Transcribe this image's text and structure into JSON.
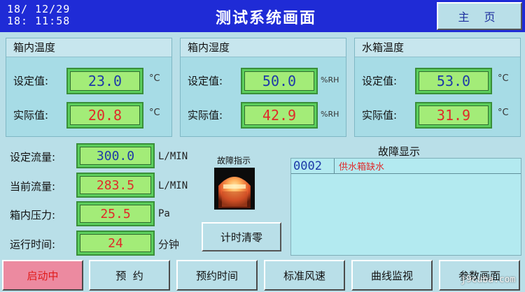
{
  "header": {
    "datetime": "18/ 12/29\n18: 11:58",
    "title": "测试系统画面",
    "home_label": "主 页"
  },
  "panels": [
    {
      "title": "箱内温度",
      "set_label": "设定值:",
      "set_value": "23.0",
      "actual_label": "实际值:",
      "actual_value": "20.8",
      "unit": "°C"
    },
    {
      "title": "箱内湿度",
      "set_label": "设定值:",
      "set_value": "50.0",
      "actual_label": "实际值:",
      "actual_value": "42.9",
      "unit": "%RH"
    },
    {
      "title": "水箱温度",
      "set_label": "设定值:",
      "set_value": "53.0",
      "actual_label": "实际值:",
      "actual_value": "31.9",
      "unit": "°C"
    }
  ],
  "flow": {
    "set_flow_label": "设定流量:",
    "set_flow_value": "300.0",
    "set_flow_unit": "L/MIN",
    "current_flow_label": "当前流量:",
    "current_flow_value": "283.5",
    "current_flow_unit": "L/MIN",
    "pressure_label": "箱内压力:",
    "pressure_value": "25.5",
    "pressure_unit": "Pa",
    "runtime_label": "运行时间:",
    "runtime_value": "24",
    "runtime_unit": "分钟"
  },
  "fault_indicator": {
    "label": "故障指示"
  },
  "timer_reset_label": "计时清零",
  "fault_display": {
    "title": "故障显示",
    "items": [
      {
        "code": "0002",
        "message": "供水箱缺水"
      }
    ]
  },
  "bottom_buttons": [
    {
      "label": "启动中",
      "active": true
    },
    {
      "label": "预  约"
    },
    {
      "label": "预约时间"
    },
    {
      "label": "标准风速"
    },
    {
      "label": "曲线监视"
    },
    {
      "label": "参数画面"
    }
  ],
  "watermark": "j9cuba.com",
  "colors": {
    "title_bar": "#1f2bd6",
    "background": "#b9dfe8",
    "value_green": "#a3ec78",
    "set_value_text": "#1d3aa8",
    "actual_value_text": "#e02a2a",
    "active_button": "#ec8aa0"
  }
}
